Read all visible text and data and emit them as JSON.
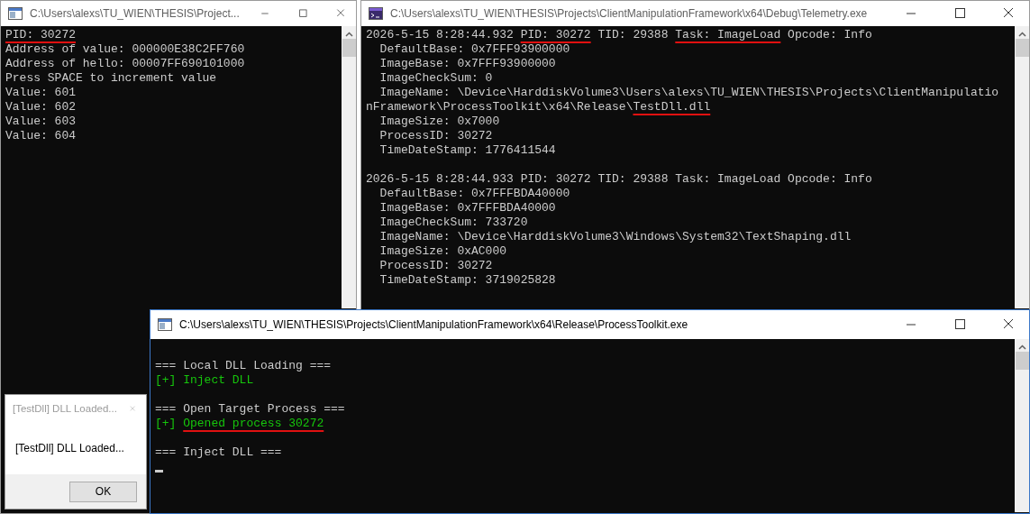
{
  "windows": [
    {
      "kind": "console",
      "title": "C:\\Users\\alexs\\TU_WIEN\\THESIS\\Project...",
      "active": false,
      "cursor": false,
      "blocks": [
        [
          {
            "kind": "plain",
            "segments": [
              {
                "text": "PID: 30272",
                "underlined": true
              }
            ]
          },
          {
            "kind": "plain",
            "segments": [
              {
                "text": "Address of value: 000000E38C2FF760",
                "underlined": false
              }
            ]
          },
          {
            "kind": "plain",
            "segments": [
              {
                "text": "Address of hello: 00007FF690101000",
                "underlined": false
              }
            ]
          },
          {
            "kind": "plain",
            "segments": [
              {
                "text": "Press SPACE to increment value",
                "underlined": false
              }
            ]
          },
          {
            "kind": "plain",
            "segments": [
              {
                "text": "Value: 601",
                "underlined": false
              }
            ]
          },
          {
            "kind": "plain",
            "segments": [
              {
                "text": "Value: 602",
                "underlined": false
              }
            ]
          },
          {
            "kind": "plain",
            "segments": [
              {
                "text": "Value: 603",
                "underlined": false
              }
            ]
          },
          {
            "kind": "plain",
            "segments": [
              {
                "text": "Value: 604",
                "underlined": false
              }
            ]
          }
        ]
      ]
    },
    {
      "kind": "console",
      "title": "C:\\Users\\alexs\\TU_WIEN\\THESIS\\Projects\\ClientManipulationFramework\\x64\\Debug\\Telemetry.exe",
      "active": false,
      "cursor": false,
      "blocks": [
        [
          {
            "kind": "plain",
            "segments": [
              {
                "text": "2026-5-15 8:28:44.932 ",
                "underlined": false
              },
              {
                "text": "PID: 30272",
                "underlined": true
              },
              {
                "text": " TID: 29388 ",
                "underlined": false
              },
              {
                "text": "Task: ImageLoad",
                "underlined": true
              },
              {
                "text": " Opcode: Info",
                "underlined": false
              }
            ]
          },
          {
            "kind": "plain",
            "segments": [
              {
                "text": "  DefaultBase: 0x7FFF93900000",
                "underlined": false
              }
            ]
          },
          {
            "kind": "plain",
            "segments": [
              {
                "text": "  ImageBase: 0x7FFF93900000",
                "underlined": false
              }
            ]
          },
          {
            "kind": "plain",
            "segments": [
              {
                "text": "  ImageCheckSum: 0",
                "underlined": false
              }
            ]
          },
          {
            "kind": "plain",
            "segments": [
              {
                "text": "  ImageName: \\Device\\HarddiskVolume3\\Users\\alexs\\TU_WIEN\\THESIS\\Projects\\ClientManipulatio",
                "underlined": false
              }
            ]
          },
          {
            "kind": "plain",
            "segments": [
              {
                "text": "nFramework\\ProcessToolkit\\x64\\Release\\",
                "underlined": false
              },
              {
                "text": "TestDll.dll",
                "underlined": true
              }
            ]
          },
          {
            "kind": "plain",
            "segments": [
              {
                "text": "  ImageSize: 0x7000",
                "underlined": false
              }
            ]
          },
          {
            "kind": "plain",
            "segments": [
              {
                "text": "  ProcessID: 30272",
                "underlined": false
              }
            ]
          },
          {
            "kind": "plain",
            "segments": [
              {
                "text": "  TimeDateStamp: 1776411544",
                "underlined": false
              }
            ]
          }
        ],
        [
          {
            "kind": "plain",
            "segments": [
              {
                "text": "2026-5-15 8:28:44.933 PID: 30272 TID: 29388 Task: ImageLoad Opcode: Info",
                "underlined": false
              }
            ]
          },
          {
            "kind": "plain",
            "segments": [
              {
                "text": "  DefaultBase: 0x7FFFBDA40000",
                "underlined": false
              }
            ]
          },
          {
            "kind": "plain",
            "segments": [
              {
                "text": "  ImageBase: 0x7FFFBDA40000",
                "underlined": false
              }
            ]
          },
          {
            "kind": "plain",
            "segments": [
              {
                "text": "  ImageCheckSum: 733720",
                "underlined": false
              }
            ]
          },
          {
            "kind": "plain",
            "segments": [
              {
                "text": "  ImageName: \\Device\\HarddiskVolume3\\Windows\\System32\\TextShaping.dll",
                "underlined": false
              }
            ]
          },
          {
            "kind": "plain",
            "segments": [
              {
                "text": "  ImageSize: 0xAC000",
                "underlined": false
              }
            ]
          },
          {
            "kind": "plain",
            "segments": [
              {
                "text": "  ProcessID: 30272",
                "underlined": false
              }
            ]
          },
          {
            "kind": "plain",
            "segments": [
              {
                "text": "  TimeDateStamp: 3719025828",
                "underlined": false
              }
            ]
          }
        ]
      ]
    },
    {
      "kind": "console",
      "title": "C:\\Users\\alexs\\TU_WIEN\\THESIS\\Projects\\ClientManipulationFramework\\x64\\Release\\ProcessToolkit.exe",
      "active": true,
      "cursor": true,
      "blocks": [
        [
          {
            "kind": "plain",
            "segments": [
              {
                "text": "=== Local DLL Loading ===",
                "underlined": false
              }
            ]
          },
          {
            "kind": "success",
            "segments": [
              {
                "text": "[+] Inject DLL",
                "underlined": false
              }
            ]
          }
        ],
        [
          {
            "kind": "plain",
            "segments": [
              {
                "text": "=== Open Target Process ===",
                "underlined": false
              }
            ]
          },
          {
            "kind": "success",
            "segments": [
              {
                "text": "[+] ",
                "underlined": false
              },
              {
                "text": "Opened process 30272",
                "underlined": true
              }
            ]
          }
        ],
        [
          {
            "kind": "plain",
            "segments": [
              {
                "text": "=== Inject DLL ===",
                "underlined": false
              }
            ]
          }
        ]
      ]
    },
    {
      "kind": "message",
      "title": "[TestDll] DLL Loaded...",
      "active": false,
      "message": "[TestDll] DLL Loaded...",
      "button": "OK"
    }
  ]
}
